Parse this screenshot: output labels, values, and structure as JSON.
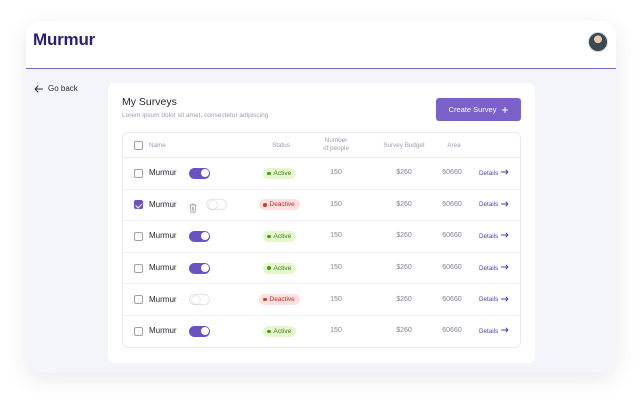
{
  "app": {
    "logo_text": "Murmur",
    "avatar_label": "User avatar"
  },
  "nav": {
    "back_label": "Go back"
  },
  "page": {
    "title": "My Surveys",
    "subtitle": "Lorem ipsum dolor sit amet, consectetur adipiscing",
    "create_button": "Create Survey",
    "create_icon": "plus-icon"
  },
  "colors": {
    "accent": "#7b62c9",
    "active_bg": "#e6f7cf",
    "active_text": "#3f7d16",
    "deactive_bg": "#fde1de",
    "deactive_text": "#b4302a"
  },
  "table": {
    "headers": {
      "name": "Name",
      "status": "Status",
      "people_line1": "Number",
      "people_line2": "of people",
      "budget": "Survey Budget",
      "area": "Area"
    },
    "rows": [
      {
        "checked": false,
        "name": "Murmur",
        "enabled": true,
        "show_trash": false,
        "status": "Active",
        "people": "150",
        "budget": "$260",
        "area": "60660",
        "details": "Details"
      },
      {
        "checked": true,
        "name": "Murmur",
        "enabled": false,
        "show_trash": true,
        "status": "Deactive",
        "people": "150",
        "budget": "$260",
        "area": "60660",
        "details": "Details"
      },
      {
        "checked": false,
        "name": "Murmur",
        "enabled": true,
        "show_trash": false,
        "status": "Active",
        "people": "150",
        "budget": "$260",
        "area": "60660",
        "details": "Details"
      },
      {
        "checked": false,
        "name": "Murmur",
        "enabled": true,
        "show_trash": false,
        "status": "Active",
        "people": "150",
        "budget": "$260",
        "area": "60660",
        "details": "Details"
      },
      {
        "checked": false,
        "name": "Murmur",
        "enabled": false,
        "show_trash": false,
        "status": "Deactive",
        "people": "150",
        "budget": "$260",
        "area": "60660",
        "details": "Details"
      },
      {
        "checked": false,
        "name": "Murmur",
        "enabled": true,
        "show_trash": false,
        "status": "Active",
        "people": "150",
        "budget": "$260",
        "area": "60660",
        "details": "Details"
      }
    ]
  }
}
